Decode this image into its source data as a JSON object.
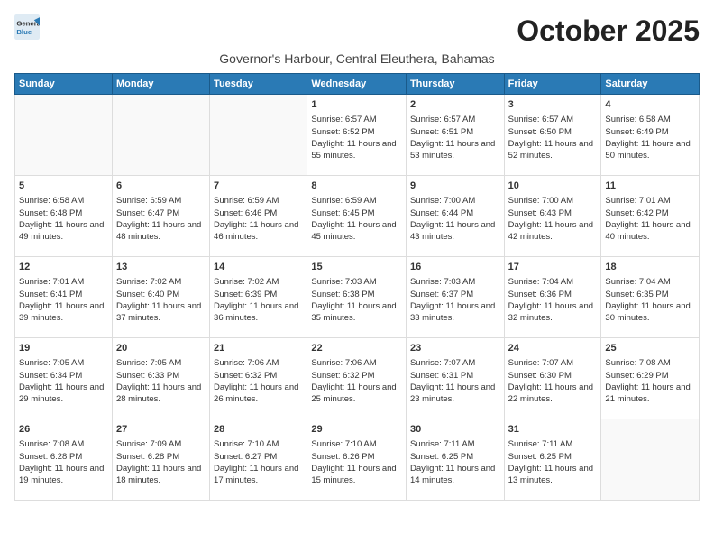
{
  "logo": {
    "line1": "General",
    "line2": "Blue"
  },
  "title": "October 2025",
  "subtitle": "Governor's Harbour, Central Eleuthera, Bahamas",
  "weekdays": [
    "Sunday",
    "Monday",
    "Tuesday",
    "Wednesday",
    "Thursday",
    "Friday",
    "Saturday"
  ],
  "weeks": [
    [
      {
        "day": "",
        "sunrise": "",
        "sunset": "",
        "daylight": ""
      },
      {
        "day": "",
        "sunrise": "",
        "sunset": "",
        "daylight": ""
      },
      {
        "day": "",
        "sunrise": "",
        "sunset": "",
        "daylight": ""
      },
      {
        "day": "1",
        "sunrise": "6:57 AM",
        "sunset": "6:52 PM",
        "daylight": "11 hours and 55 minutes."
      },
      {
        "day": "2",
        "sunrise": "6:57 AM",
        "sunset": "6:51 PM",
        "daylight": "11 hours and 53 minutes."
      },
      {
        "day": "3",
        "sunrise": "6:57 AM",
        "sunset": "6:50 PM",
        "daylight": "11 hours and 52 minutes."
      },
      {
        "day": "4",
        "sunrise": "6:58 AM",
        "sunset": "6:49 PM",
        "daylight": "11 hours and 50 minutes."
      }
    ],
    [
      {
        "day": "5",
        "sunrise": "6:58 AM",
        "sunset": "6:48 PM",
        "daylight": "11 hours and 49 minutes."
      },
      {
        "day": "6",
        "sunrise": "6:59 AM",
        "sunset": "6:47 PM",
        "daylight": "11 hours and 48 minutes."
      },
      {
        "day": "7",
        "sunrise": "6:59 AM",
        "sunset": "6:46 PM",
        "daylight": "11 hours and 46 minutes."
      },
      {
        "day": "8",
        "sunrise": "6:59 AM",
        "sunset": "6:45 PM",
        "daylight": "11 hours and 45 minutes."
      },
      {
        "day": "9",
        "sunrise": "7:00 AM",
        "sunset": "6:44 PM",
        "daylight": "11 hours and 43 minutes."
      },
      {
        "day": "10",
        "sunrise": "7:00 AM",
        "sunset": "6:43 PM",
        "daylight": "11 hours and 42 minutes."
      },
      {
        "day": "11",
        "sunrise": "7:01 AM",
        "sunset": "6:42 PM",
        "daylight": "11 hours and 40 minutes."
      }
    ],
    [
      {
        "day": "12",
        "sunrise": "7:01 AM",
        "sunset": "6:41 PM",
        "daylight": "11 hours and 39 minutes."
      },
      {
        "day": "13",
        "sunrise": "7:02 AM",
        "sunset": "6:40 PM",
        "daylight": "11 hours and 37 minutes."
      },
      {
        "day": "14",
        "sunrise": "7:02 AM",
        "sunset": "6:39 PM",
        "daylight": "11 hours and 36 minutes."
      },
      {
        "day": "15",
        "sunrise": "7:03 AM",
        "sunset": "6:38 PM",
        "daylight": "11 hours and 35 minutes."
      },
      {
        "day": "16",
        "sunrise": "7:03 AM",
        "sunset": "6:37 PM",
        "daylight": "11 hours and 33 minutes."
      },
      {
        "day": "17",
        "sunrise": "7:04 AM",
        "sunset": "6:36 PM",
        "daylight": "11 hours and 32 minutes."
      },
      {
        "day": "18",
        "sunrise": "7:04 AM",
        "sunset": "6:35 PM",
        "daylight": "11 hours and 30 minutes."
      }
    ],
    [
      {
        "day": "19",
        "sunrise": "7:05 AM",
        "sunset": "6:34 PM",
        "daylight": "11 hours and 29 minutes."
      },
      {
        "day": "20",
        "sunrise": "7:05 AM",
        "sunset": "6:33 PM",
        "daylight": "11 hours and 28 minutes."
      },
      {
        "day": "21",
        "sunrise": "7:06 AM",
        "sunset": "6:32 PM",
        "daylight": "11 hours and 26 minutes."
      },
      {
        "day": "22",
        "sunrise": "7:06 AM",
        "sunset": "6:32 PM",
        "daylight": "11 hours and 25 minutes."
      },
      {
        "day": "23",
        "sunrise": "7:07 AM",
        "sunset": "6:31 PM",
        "daylight": "11 hours and 23 minutes."
      },
      {
        "day": "24",
        "sunrise": "7:07 AM",
        "sunset": "6:30 PM",
        "daylight": "11 hours and 22 minutes."
      },
      {
        "day": "25",
        "sunrise": "7:08 AM",
        "sunset": "6:29 PM",
        "daylight": "11 hours and 21 minutes."
      }
    ],
    [
      {
        "day": "26",
        "sunrise": "7:08 AM",
        "sunset": "6:28 PM",
        "daylight": "11 hours and 19 minutes."
      },
      {
        "day": "27",
        "sunrise": "7:09 AM",
        "sunset": "6:28 PM",
        "daylight": "11 hours and 18 minutes."
      },
      {
        "day": "28",
        "sunrise": "7:10 AM",
        "sunset": "6:27 PM",
        "daylight": "11 hours and 17 minutes."
      },
      {
        "day": "29",
        "sunrise": "7:10 AM",
        "sunset": "6:26 PM",
        "daylight": "11 hours and 15 minutes."
      },
      {
        "day": "30",
        "sunrise": "7:11 AM",
        "sunset": "6:25 PM",
        "daylight": "11 hours and 14 minutes."
      },
      {
        "day": "31",
        "sunrise": "7:11 AM",
        "sunset": "6:25 PM",
        "daylight": "11 hours and 13 minutes."
      },
      {
        "day": "",
        "sunrise": "",
        "sunset": "",
        "daylight": ""
      }
    ]
  ]
}
